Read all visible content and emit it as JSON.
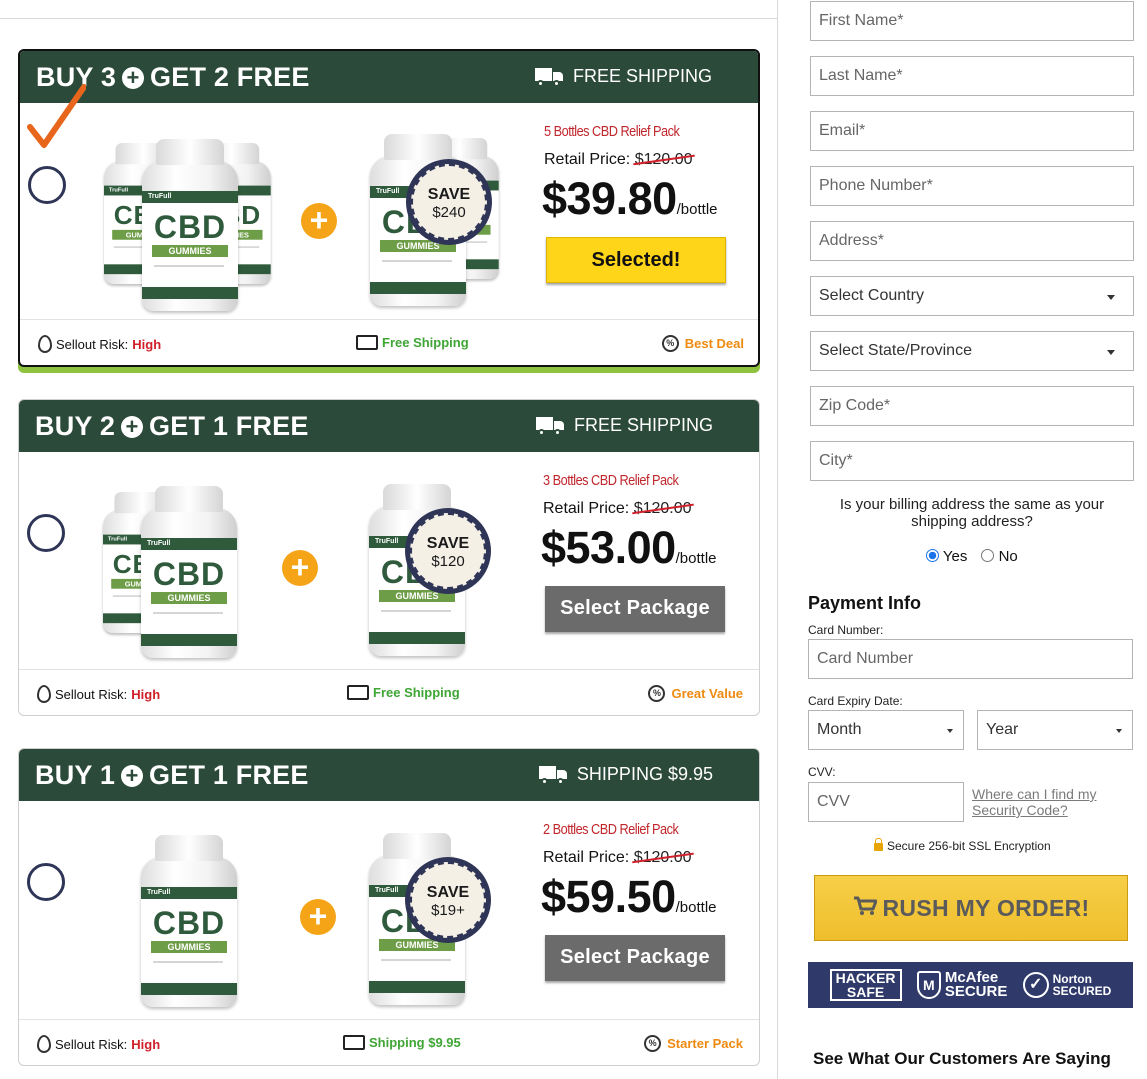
{
  "packages": [
    {
      "title_left": "BUY 3",
      "title_right": "GET 2 FREE",
      "shipping_header": "FREE SHIPPING",
      "pack_name": "5 Bottles CBD Relief Pack",
      "retail_label": "Retail Price: ",
      "retail_price": "$120.00",
      "price": "$39.80",
      "per": "/bottle",
      "button": "Selected!",
      "selected": true,
      "save_top": "SAVE",
      "save_amount": "$240",
      "footer": {
        "risk_label": "Sellout Risk:",
        "risk_value": "High",
        "shipping": "Free Shipping",
        "tag": "Best Deal"
      }
    },
    {
      "title_left": "BUY 2",
      "title_right": "GET 1 FREE",
      "shipping_header": "FREE SHIPPING",
      "pack_name": "3 Bottles CBD Relief Pack",
      "retail_label": "Retail Price: ",
      "retail_price": "$120.00",
      "price": "$53.00",
      "per": "/bottle",
      "button": "Select Package",
      "selected": false,
      "save_top": "SAVE",
      "save_amount": "$120",
      "footer": {
        "risk_label": "Sellout Risk:",
        "risk_value": "High",
        "shipping": "Free Shipping",
        "tag": "Great Value"
      }
    },
    {
      "title_left": "BUY 1",
      "title_right": "GET 1 FREE",
      "shipping_header": "SHIPPING $9.95",
      "pack_name": "2 Bottles CBD Relief Pack",
      "retail_label": "Retail Price: ",
      "retail_price": "$120.00",
      "price": "$59.50",
      "per": "/bottle",
      "button": "Select Package",
      "selected": false,
      "save_top": "SAVE",
      "save_amount": "$19+",
      "footer": {
        "risk_label": "Sellout Risk:",
        "risk_value": "High",
        "shipping": "Shipping $9.95",
        "tag": "Starter Pack"
      }
    }
  ],
  "bottle_text": {
    "brand": "TruFull",
    "cbd": "CBD",
    "gummies": "GUMMIES"
  },
  "form": {
    "first_name": "First Name*",
    "last_name": "Last Name*",
    "email": "Email*",
    "phone": "Phone Number*",
    "address": "Address*",
    "country": "Select Country",
    "state": "Select State/Province",
    "zip": "Zip Code*",
    "city": "City*",
    "billing_question": "Is your billing address the same as your shipping address?",
    "billing_yes": "Yes",
    "billing_no": "No",
    "billing_selected": "Yes"
  },
  "payment": {
    "title": "Payment Info",
    "card_number_label": "Card Number:",
    "card_number_placeholder": "Card Number",
    "expiry_label": "Card Expiry Date:",
    "month": "Month",
    "year": "Year",
    "cvv_label": "CVV:",
    "cvv_placeholder": "CVV",
    "cvv_help": "Where can I find my Security Code?",
    "ssl": "Secure 256-bit SSL Encryption",
    "submit": "RUSH MY ORDER!"
  },
  "trust_badges": {
    "hacker_safe_line1": "HACKER",
    "hacker_safe_line2": "SAFE",
    "mcafee_line1": "McAfee",
    "mcafee_line2": "SECURE",
    "norton_line1": "Norton",
    "norton_line2": "SECURED"
  },
  "customers_heading": "See What Our Customers Are Saying",
  "colors": {
    "header_green": "#2c4a3a",
    "accent_yellow": "#ffd51a",
    "risk_red": "#d0202a",
    "ship_green": "#3fa535",
    "tag_orange": "#ef8a10",
    "trust_navy": "#2f3a6b"
  }
}
